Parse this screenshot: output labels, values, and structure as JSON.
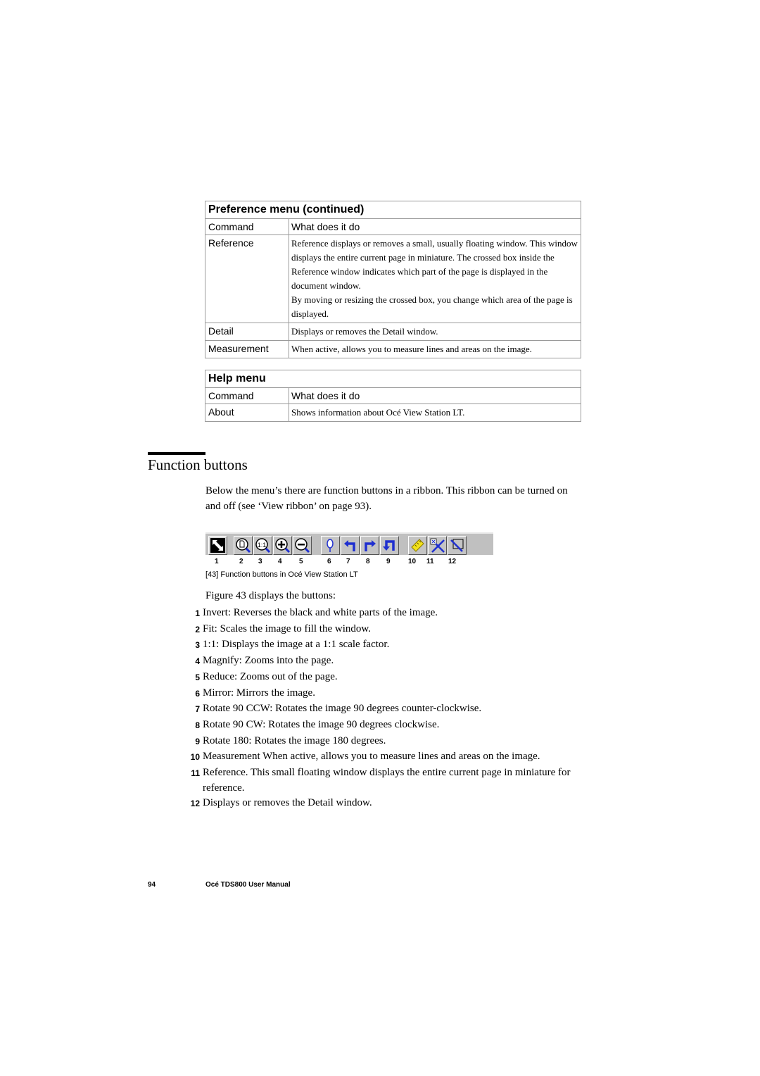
{
  "preference_table": {
    "title": "Preference menu (continued)",
    "header": {
      "command": "Command",
      "description": "What does it do"
    },
    "rows": [
      {
        "command": "Reference",
        "description": [
          "Reference displays or removes a small, usually floating window. This window displays the entire current page in miniature. The crossed box inside the Reference window indicates which part of the page is displayed in the document window.",
          "By moving or resizing the crossed box, you change which area of the page is displayed."
        ]
      },
      {
        "command": "Detail",
        "description": [
          "Displays or removes the Detail window."
        ]
      },
      {
        "command": "Measurement",
        "description": [
          "When active, allows you to measure lines and areas on the image."
        ]
      }
    ]
  },
  "help_table": {
    "title": "Help menu",
    "header": {
      "command": "Command",
      "description": "What does it do"
    },
    "rows": [
      {
        "command": "About",
        "description": [
          "Shows information about Océ View Station LT."
        ]
      }
    ]
  },
  "section": {
    "title": "Function buttons",
    "intro": "Below the menu’s there are function buttons in a ribbon. This ribbon can be turned on and off (see ‘View ribbon’ on page 93)."
  },
  "ribbon": {
    "buttons": [
      {
        "num": "1",
        "icon": "invert-icon"
      },
      {
        "num": "2",
        "icon": "fit-icon"
      },
      {
        "num": "3",
        "icon": "one-to-one-icon"
      },
      {
        "num": "4",
        "icon": "magnify-icon"
      },
      {
        "num": "5",
        "icon": "reduce-icon"
      },
      {
        "num": "6",
        "icon": "mirror-icon"
      },
      {
        "num": "7",
        "icon": "rotate-ccw-icon"
      },
      {
        "num": "8",
        "icon": "rotate-cw-icon"
      },
      {
        "num": "9",
        "icon": "rotate-180-icon"
      },
      {
        "num": "10",
        "icon": "measurement-ruler-icon"
      },
      {
        "num": "11",
        "icon": "reference-icon"
      },
      {
        "num": "12",
        "icon": "detail-icon"
      }
    ],
    "colors": {
      "accent_blue": "#1f2fd0",
      "ruler_yellow": "#f2e21a",
      "face": "#c0c0c0"
    }
  },
  "figure_caption": "[43] Function buttons in Océ View Station LT",
  "list_lead": "Figure 43 displays the buttons:",
  "list": [
    {
      "num": "1",
      "text": "Invert: Reverses the black and white parts of the image."
    },
    {
      "num": "2",
      "text": "Fit: Scales the image to fill the window."
    },
    {
      "num": "3",
      "text": "1:1: Displays the image at a 1:1 scale factor."
    },
    {
      "num": "4",
      "text": "Magnify: Zooms into the page."
    },
    {
      "num": "5",
      "text": "Reduce: Zooms out of the page."
    },
    {
      "num": "6",
      "text": "Mirror: Mirrors the image."
    },
    {
      "num": "7",
      "text": "Rotate 90 CCW: Rotates the image 90 degrees counter-clockwise."
    },
    {
      "num": "8",
      "text": "Rotate 90 CW: Rotates the image 90 degrees clockwise."
    },
    {
      "num": "9",
      "text": "Rotate 180: Rotates the image 180 degrees."
    },
    {
      "num": "10",
      "text": "Measurement When active, allows you to measure lines and areas on the image."
    },
    {
      "num": "11",
      "text": "Reference. This small floating window displays the entire current page in miniature for reference."
    },
    {
      "num": "12",
      "text": "Displays or removes the Detail window."
    }
  ],
  "footer": {
    "page_number": "94",
    "title": "Océ TDS800 User Manual"
  }
}
